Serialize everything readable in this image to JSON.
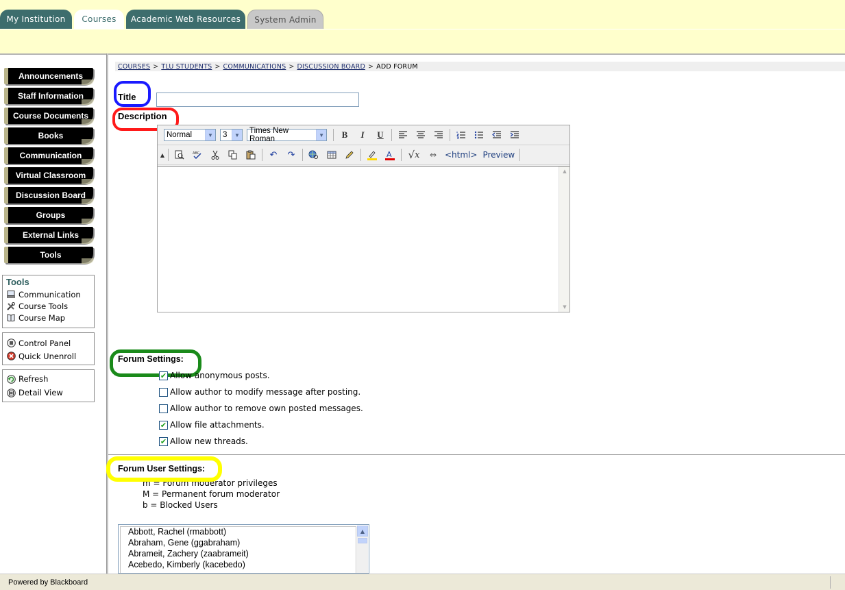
{
  "tabs": [
    {
      "label": "My Institution",
      "state": "dark"
    },
    {
      "label": "Courses",
      "state": "active"
    },
    {
      "label": "Academic Web Resources",
      "state": "dark"
    },
    {
      "label": "System Admin",
      "state": "grey"
    }
  ],
  "nav_buttons": [
    "Announcements",
    "Staff Information",
    "Course Documents",
    "Books",
    "Communication",
    "Virtual Classroom",
    "Discussion Board",
    "Groups",
    "External Links",
    "Tools"
  ],
  "tools_panel": {
    "title": "Tools",
    "items": [
      {
        "label": "Communication",
        "icon": "computer-icon"
      },
      {
        "label": "Course Tools",
        "icon": "tools-icon"
      },
      {
        "label": "Course Map",
        "icon": "map-book-icon"
      }
    ]
  },
  "control_panel": {
    "items": [
      {
        "label": "Control Panel",
        "icon": "control-panel-icon"
      },
      {
        "label": "Quick Unenroll",
        "icon": "unenroll-icon"
      }
    ]
  },
  "view_panel": {
    "items": [
      {
        "label": "Refresh",
        "icon": "refresh-icon"
      },
      {
        "label": "Detail View",
        "icon": "detail-view-icon"
      }
    ]
  },
  "breadcrumb": {
    "links": [
      "COURSES",
      "TLU STUDENTS",
      "COMMUNICATIONS",
      "DISCUSSION BOARD"
    ],
    "current": "ADD FORUM",
    "separator": ">"
  },
  "form": {
    "title_label": "Title",
    "title_value": "",
    "description_label": "Description",
    "forum_settings_label": "Forum Settings:",
    "forum_user_settings_label": "Forum User Settings:"
  },
  "editor": {
    "paragraph_format": "Normal",
    "font_size": "3",
    "font_name": "Times New Roman",
    "html_label": "<html>",
    "preview_label": "Preview"
  },
  "forum_settings": [
    {
      "label": "Allow anonymous posts.",
      "checked": true
    },
    {
      "label": "Allow author to modify message after posting.",
      "checked": false
    },
    {
      "label": "Allow author to remove own posted messages.",
      "checked": false
    },
    {
      "label": "Allow file attachments.",
      "checked": true
    },
    {
      "label": "Allow new threads.",
      "checked": true
    }
  ],
  "user_legend": [
    "m = Forum moderator privileges",
    "M = Permanent forum moderator",
    "b = Blocked Users"
  ],
  "users": [
    "Abbott, Rachel  (rmabbott)",
    "Abraham, Gene  (ggabraham)",
    "Abrameit, Zachery  (zaabrameit)",
    "Acebedo, Kimberly  (kacebedo)"
  ],
  "status_bar": {
    "text": "Powered by Blackboard"
  },
  "colors": {
    "tab_dark": "#3d6d6d",
    "banner": "#ffffcc",
    "highlight_title": "#0000ff",
    "highlight_description": "#ff0000",
    "highlight_forum_settings": "#008000",
    "highlight_user_settings": "#ffff00"
  }
}
